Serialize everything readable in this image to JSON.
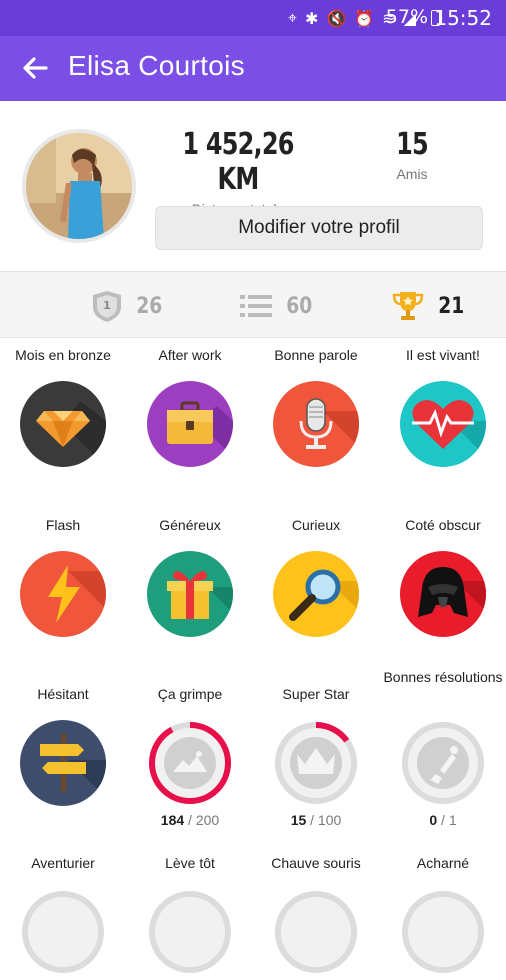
{
  "status_bar": {
    "battery": "57%",
    "time": "15:52"
  },
  "app_bar": {
    "title": "Elisa Courtois"
  },
  "profile": {
    "distance_value": "1 452,26 KM",
    "distance_label": "Distance totale",
    "friends_value": "15",
    "friends_label": "Amis",
    "edit_button": "Modifier votre profil"
  },
  "summary": {
    "rank_count": "26",
    "list_count": "60",
    "trophy_count": "21"
  },
  "badges": [
    {
      "name": "Mois en bronze",
      "icon": "diamond-icon",
      "color": "#3a3a3a"
    },
    {
      "name": "After work",
      "icon": "briefcase-icon",
      "color": "#9b3fc0"
    },
    {
      "name": "Bonne parole",
      "icon": "microphone-icon",
      "color": "#f0563c"
    },
    {
      "name": "Il est vivant!",
      "icon": "heart-icon",
      "color": "#1fc6c6"
    },
    {
      "name": "Flash",
      "icon": "lightning-icon",
      "color": "#f0563c"
    },
    {
      "name": "Généreux",
      "icon": "gift-icon",
      "color": "#1e9e7c"
    },
    {
      "name": "Curieux",
      "icon": "magnifier-icon",
      "color": "#ffc21a"
    },
    {
      "name": "Coté obscur",
      "icon": "darth-vader-icon",
      "color": "#e81c2a"
    },
    {
      "name": "Hésitant",
      "icon": "signpost-icon",
      "color": "#3d4d6b"
    },
    {
      "name": "Ça grimpe",
      "icon": "mountain-icon",
      "progress_current": "184",
      "progress_total": "/ 200",
      "progress_fraction": 0.92
    },
    {
      "name": "Super Star",
      "icon": "crown-icon",
      "progress_current": "15",
      "progress_total": "/ 100",
      "progress_fraction": 0.15
    },
    {
      "name": "Bonnes résolutions",
      "icon": "broken-bulb-icon",
      "progress_current": "0",
      "progress_total": "/ 1",
      "progress_fraction": 0
    },
    {
      "name": "Aventurier"
    },
    {
      "name": "Lève tôt"
    },
    {
      "name": "Chauve souris"
    },
    {
      "name": "Acharné"
    }
  ]
}
